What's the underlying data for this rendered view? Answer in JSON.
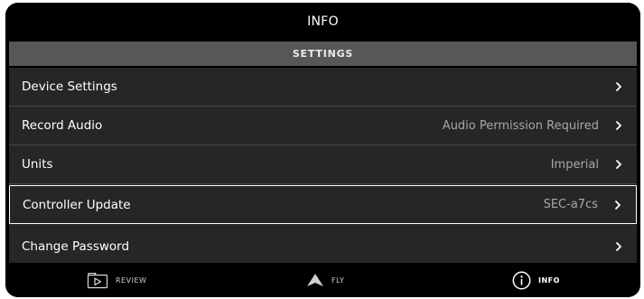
{
  "header": {
    "title": "INFO"
  },
  "section": {
    "title": "SETTINGS"
  },
  "rows": [
    {
      "label": "Device Settings",
      "value": ""
    },
    {
      "label": "Record Audio",
      "value": "Audio Permission Required"
    },
    {
      "label": "Units",
      "value": "Imperial"
    },
    {
      "label": "Controller Update",
      "value": "SEC-a7cs"
    },
    {
      "label": "Change Password",
      "value": ""
    }
  ],
  "nav": {
    "review": {
      "label": "REVIEW",
      "icon": "video-play-icon"
    },
    "fly": {
      "label": "FLY",
      "icon": "arrow-up-icon"
    },
    "info": {
      "label": "INFO",
      "icon": "info-circle-icon"
    }
  },
  "colors": {
    "background": "#000000",
    "section_bar": "#575757",
    "row_background": "#262626",
    "value_text": "#a8a8a8",
    "selected_border": "#ffffff"
  }
}
